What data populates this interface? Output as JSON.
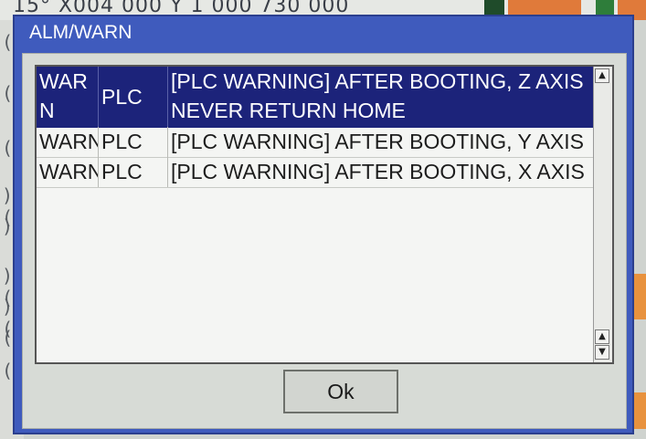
{
  "background": {
    "top_fragment": "15° X004 000 Y 1 000 730 000",
    "left_fragments": [
      "(",
      "(",
      "(",
      ")(",
      ")8",
      ")(",
      ")(",
      "(",
      "("
    ]
  },
  "dialog": {
    "title": "ALM/WARN",
    "alarms": [
      {
        "type": "WARN",
        "source": "PLC",
        "message": "[PLC WARNING] AFTER BOOTING, Z AXIS NEVER RETURN HOME",
        "selected": true
      },
      {
        "type": "WARN",
        "source": "PLC",
        "message": "[PLC WARNING] AFTER BOOTING, Y AXIS",
        "selected": false
      },
      {
        "type": "WARN",
        "source": "PLC",
        "message": "[PLC WARNING] AFTER BOOTING, X AXIS",
        "selected": false
      }
    ],
    "ok_label": "Ok"
  },
  "icons": {
    "scroll_up": "arrow-up-icon",
    "scroll_down": "arrow-down-icon"
  },
  "colors": {
    "dialog_frame": "#3f5bbd",
    "selection": "#1c237a"
  }
}
